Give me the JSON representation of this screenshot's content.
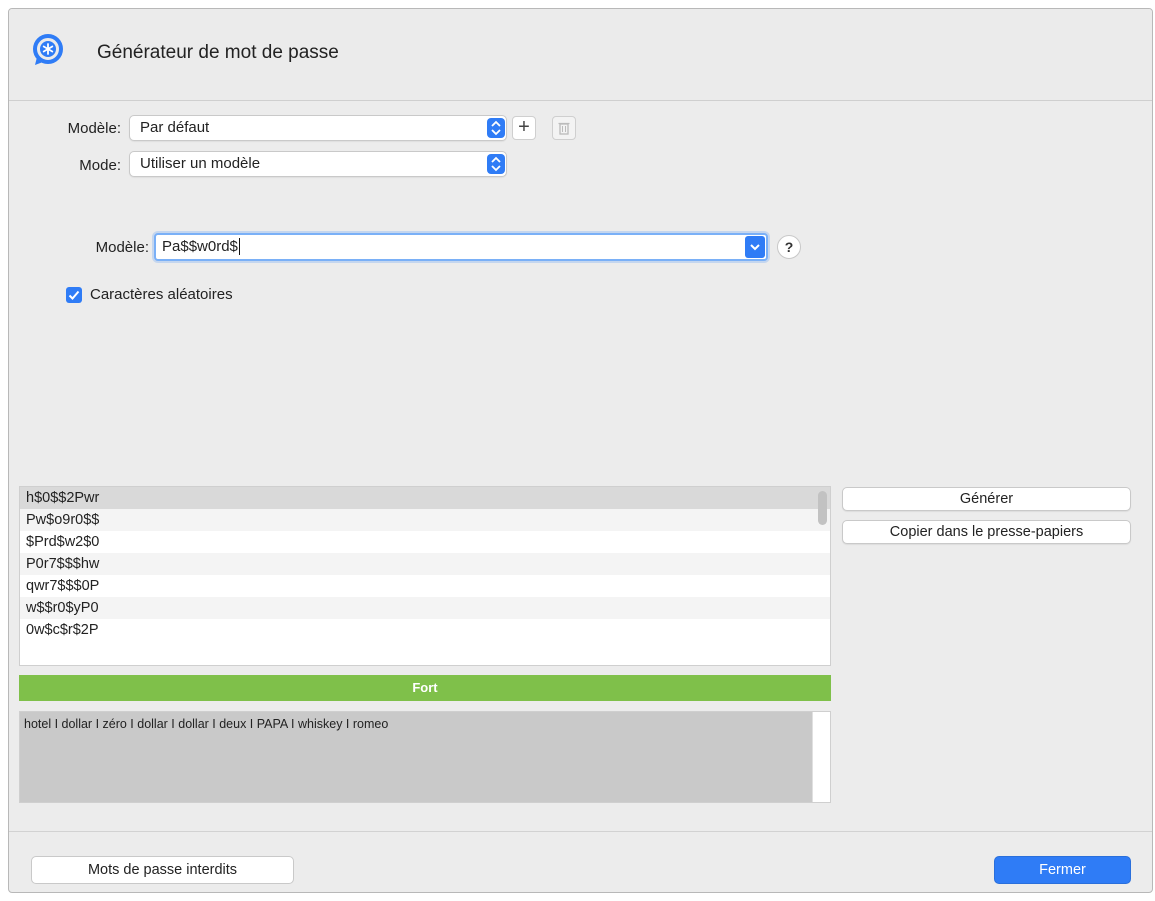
{
  "header": {
    "title": "Générateur de mot de passe"
  },
  "settings": {
    "model_label": "Modèle:",
    "model_value": "Par défaut",
    "mode_label": "Mode:",
    "mode_value": "Utiliser un modèle"
  },
  "pattern": {
    "label": "Modèle:",
    "value": "Pa$$w0rd$",
    "help": "?"
  },
  "random_chars": {
    "label": "Caractères aléatoires",
    "checked": true
  },
  "passwords": [
    "h$0$$2Pwr",
    "Pw$o9r0$$",
    "$Prd$w2$0",
    "P0r7$$$hw",
    "qwr7$$$0P",
    "w$$r0$yP0",
    "0w$c$r$2P"
  ],
  "actions": {
    "generate": "Générer",
    "copy": "Copier dans le presse-papiers"
  },
  "strength": {
    "label": "Fort",
    "color": "#7fc04a"
  },
  "phonetic": "hotel I dollar I zéro I dollar I dollar I deux I PAPA I whiskey I romeo",
  "footer": {
    "forbidden": "Mots de passe interdits",
    "close": "Fermer"
  },
  "colors": {
    "accent": "#2f7cf6"
  }
}
